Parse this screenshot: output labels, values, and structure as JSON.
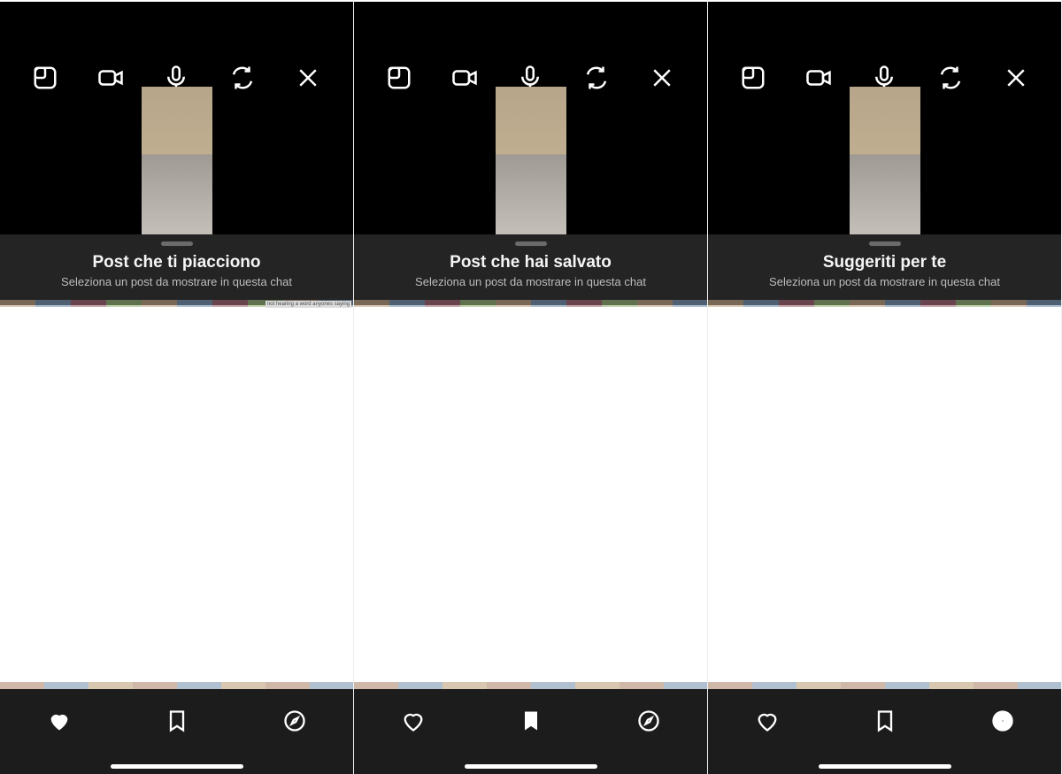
{
  "panes": [
    {
      "title": "Post che ti piacciono",
      "subtitle": "Seleziona un post da mostrare in questa chat",
      "active_tab": "heart",
      "meme_caption": "not hearing a word anyones saying"
    },
    {
      "title": "Post che hai salvato",
      "subtitle": "Seleziona un post da mostrare in questa chat",
      "active_tab": "bookmark",
      "meme_caption": ""
    },
    {
      "title": "Suggeriti per te",
      "subtitle": "Seleziona un post da mostrare in questa chat",
      "active_tab": "compass",
      "meme_caption": ""
    }
  ],
  "icons": {
    "toolbar": [
      "layout-icon",
      "video-icon",
      "mic-icon",
      "flip-icon",
      "close-icon"
    ],
    "tabs": [
      "heart-icon",
      "bookmark-icon",
      "compass-icon"
    ]
  }
}
